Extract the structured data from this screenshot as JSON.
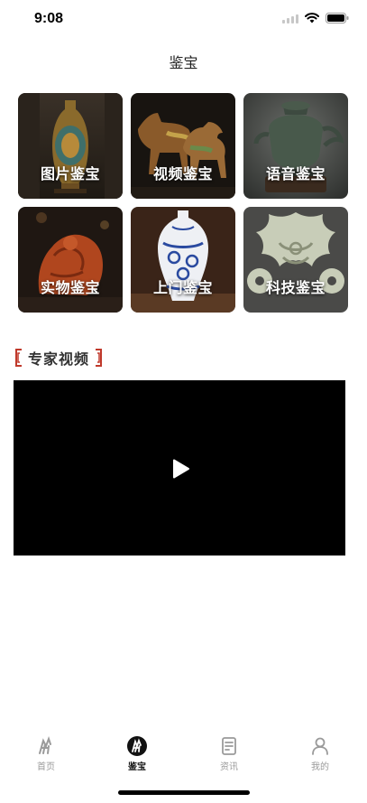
{
  "status_bar": {
    "time": "9:08"
  },
  "header": {
    "title": "鉴宝"
  },
  "grid": {
    "items": [
      {
        "label": "图片鉴宝",
        "icon": "vase-photo"
      },
      {
        "label": "视频鉴宝",
        "icon": "horses-photo"
      },
      {
        "label": "语音鉴宝",
        "icon": "bronze-vessel-photo"
      },
      {
        "label": "实物鉴宝",
        "icon": "carving-photo"
      },
      {
        "label": "上门鉴宝",
        "icon": "blue-white-vase-photo"
      },
      {
        "label": "科技鉴宝",
        "icon": "jade-pendant-photo"
      }
    ]
  },
  "section": {
    "title": "专家视频",
    "accent_color": "#c0392b"
  },
  "video": {
    "icon": "play-icon"
  },
  "tab_bar": {
    "tabs": [
      {
        "label": "首页",
        "icon": "home-icon",
        "active": false
      },
      {
        "label": "鉴宝",
        "icon": "appraise-icon",
        "active": true
      },
      {
        "label": "资讯",
        "icon": "news-icon",
        "active": false
      },
      {
        "label": "我的",
        "icon": "profile-icon",
        "active": false
      }
    ]
  }
}
